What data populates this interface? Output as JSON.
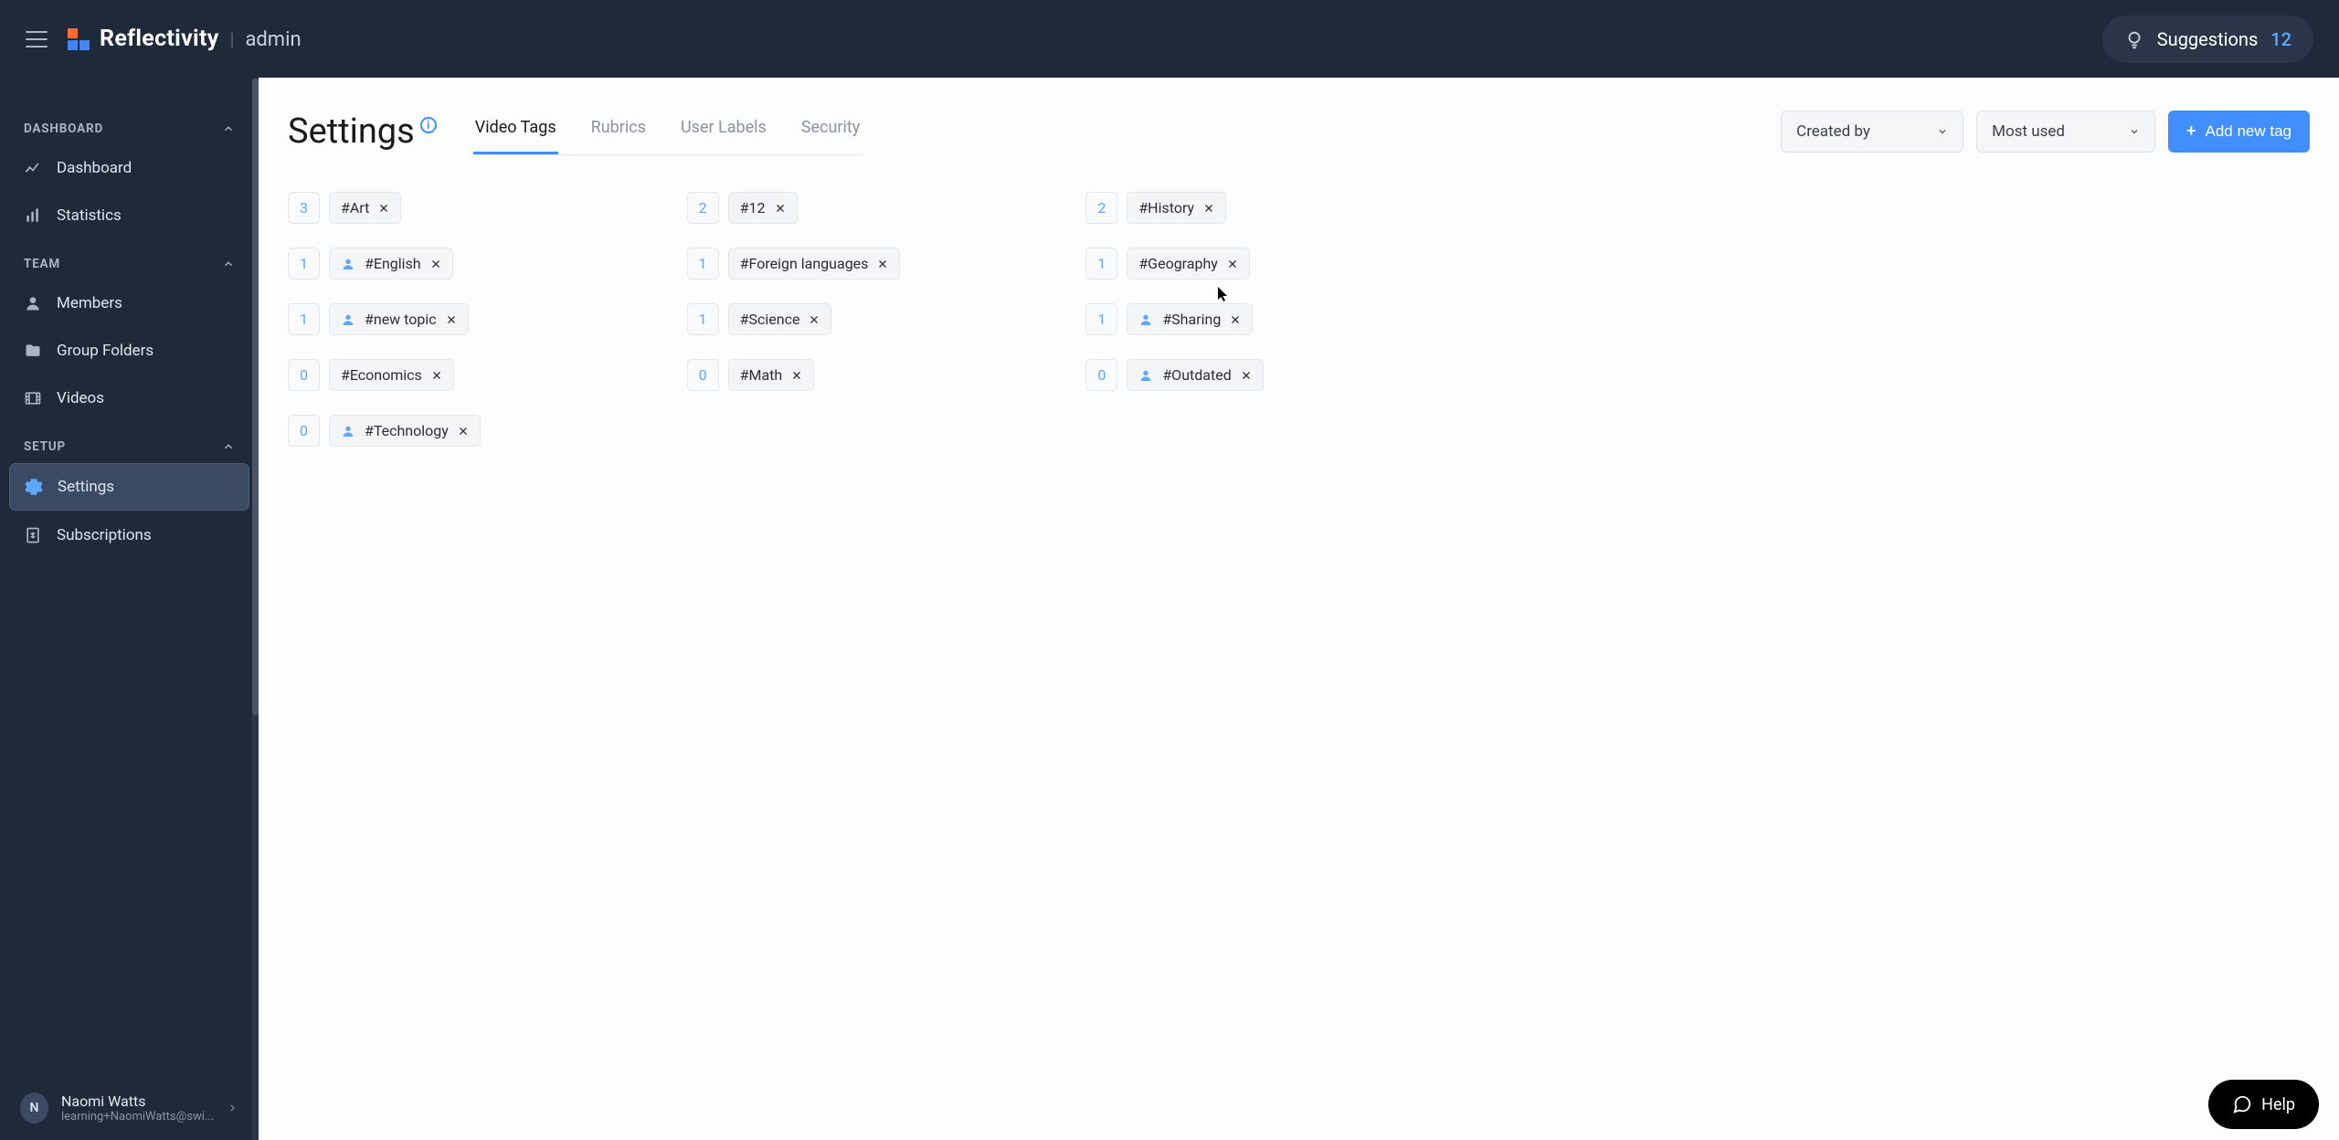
{
  "brand": {
    "name": "Reflectivity",
    "sub": "admin"
  },
  "suggestions": {
    "label": "Suggestions",
    "count": "12"
  },
  "sidebar": {
    "sections": {
      "dashboard": {
        "title": "DASHBOARD",
        "items": [
          "Dashboard",
          "Statistics"
        ]
      },
      "team": {
        "title": "TEAM",
        "items": [
          "Members",
          "Group Folders",
          "Videos"
        ]
      },
      "setup": {
        "title": "SETUP",
        "items": [
          "Settings",
          "Subscriptions"
        ]
      }
    },
    "user": {
      "name": "Naomi Watts",
      "email": "learning+NaomiWatts@swi..."
    }
  },
  "page": {
    "title": "Settings"
  },
  "tabs": [
    "Video Tags",
    "Rubrics",
    "User Labels",
    "Security"
  ],
  "filters": {
    "createdBy": "Created by",
    "sort": "Most used"
  },
  "addButton": "Add new tag",
  "tags": [
    {
      "count": "3",
      "label": "#Art",
      "hasUser": false
    },
    {
      "count": "2",
      "label": "#12",
      "hasUser": false
    },
    {
      "count": "2",
      "label": "#History",
      "hasUser": false
    },
    {
      "count": "1",
      "label": "#English",
      "hasUser": true
    },
    {
      "count": "1",
      "label": "#Foreign languages",
      "hasUser": false
    },
    {
      "count": "1",
      "label": "#Geography",
      "hasUser": false
    },
    {
      "count": "1",
      "label": "#new topic",
      "hasUser": true
    },
    {
      "count": "1",
      "label": "#Science",
      "hasUser": false
    },
    {
      "count": "1",
      "label": "#Sharing",
      "hasUser": true
    },
    {
      "count": "0",
      "label": "#Economics",
      "hasUser": false
    },
    {
      "count": "0",
      "label": "#Math",
      "hasUser": false
    },
    {
      "count": "0",
      "label": "#Outdated",
      "hasUser": true
    },
    {
      "count": "0",
      "label": "#Technology",
      "hasUser": true
    }
  ],
  "help": {
    "label": "Help"
  }
}
